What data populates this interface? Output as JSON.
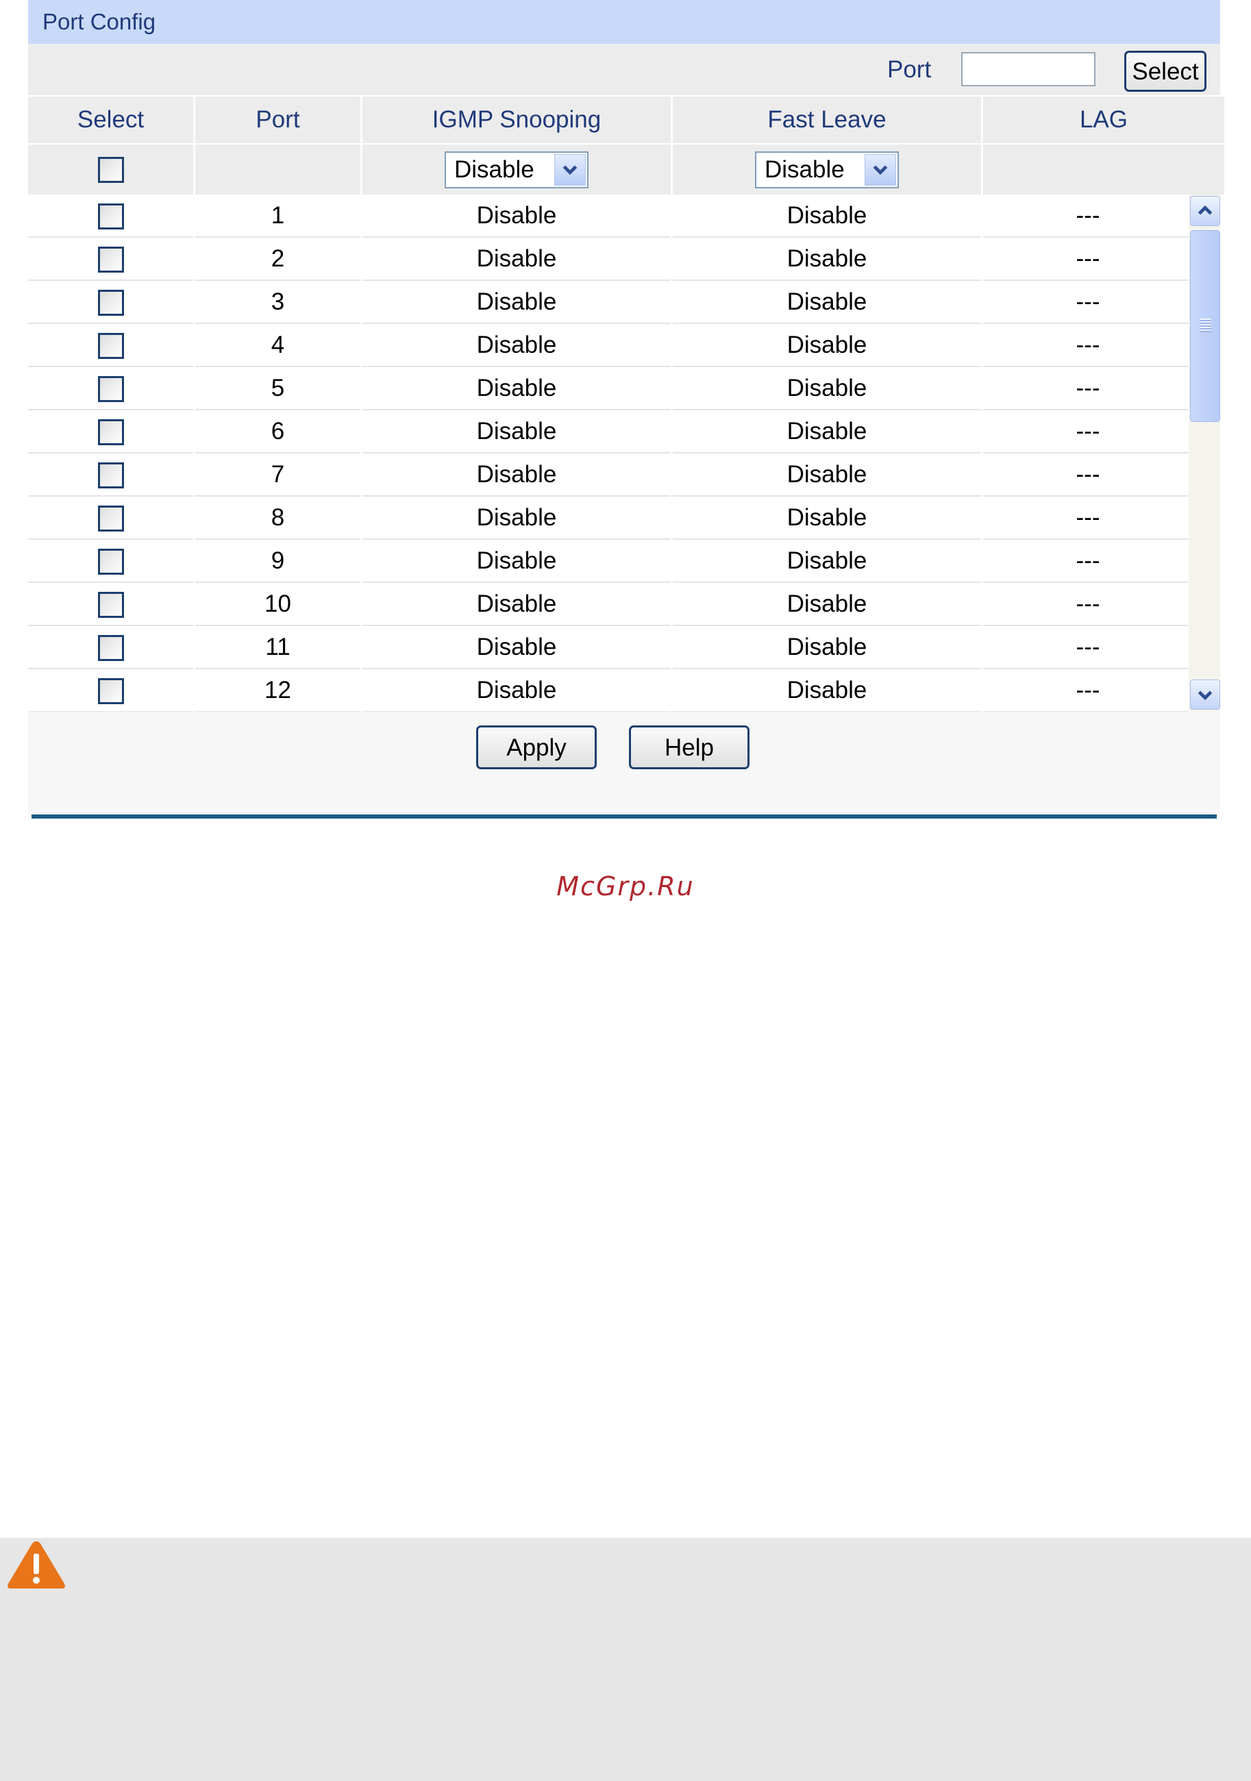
{
  "panel": {
    "title": "Port Config",
    "port_select": {
      "label": "Port",
      "input_value": "",
      "button_label": "Select"
    }
  },
  "table": {
    "headers": [
      "Select",
      "Port",
      "IGMP Snooping",
      "Fast Leave",
      "LAG"
    ],
    "controls": {
      "igmp_snooping": "Disable",
      "fast_leave": "Disable"
    },
    "rows": [
      {
        "port": "1",
        "igmp": "Disable",
        "fast_leave": "Disable",
        "lag": "---"
      },
      {
        "port": "2",
        "igmp": "Disable",
        "fast_leave": "Disable",
        "lag": "---"
      },
      {
        "port": "3",
        "igmp": "Disable",
        "fast_leave": "Disable",
        "lag": "---"
      },
      {
        "port": "4",
        "igmp": "Disable",
        "fast_leave": "Disable",
        "lag": "---"
      },
      {
        "port": "5",
        "igmp": "Disable",
        "fast_leave": "Disable",
        "lag": "---"
      },
      {
        "port": "6",
        "igmp": "Disable",
        "fast_leave": "Disable",
        "lag": "---"
      },
      {
        "port": "7",
        "igmp": "Disable",
        "fast_leave": "Disable",
        "lag": "---"
      },
      {
        "port": "8",
        "igmp": "Disable",
        "fast_leave": "Disable",
        "lag": "---"
      },
      {
        "port": "9",
        "igmp": "Disable",
        "fast_leave": "Disable",
        "lag": "---"
      },
      {
        "port": "10",
        "igmp": "Disable",
        "fast_leave": "Disable",
        "lag": "---"
      },
      {
        "port": "11",
        "igmp": "Disable",
        "fast_leave": "Disable",
        "lag": "---"
      },
      {
        "port": "12",
        "igmp": "Disable",
        "fast_leave": "Disable",
        "lag": "---"
      }
    ]
  },
  "actions": {
    "apply_label": "Apply",
    "help_label": "Help"
  },
  "watermark": "McGrp.Ru",
  "icons": {
    "warning": "warning-icon",
    "dropdown": "chevron-down-icon",
    "scroll_up": "scroll-up-icon",
    "scroll_down": "scroll-down-icon"
  },
  "colors": {
    "title_bg": "#c9daf9",
    "header_text": "#1f3a7a",
    "divider": "#1b5b86",
    "watermark": "#b0272e",
    "warning": "#e8751a"
  }
}
